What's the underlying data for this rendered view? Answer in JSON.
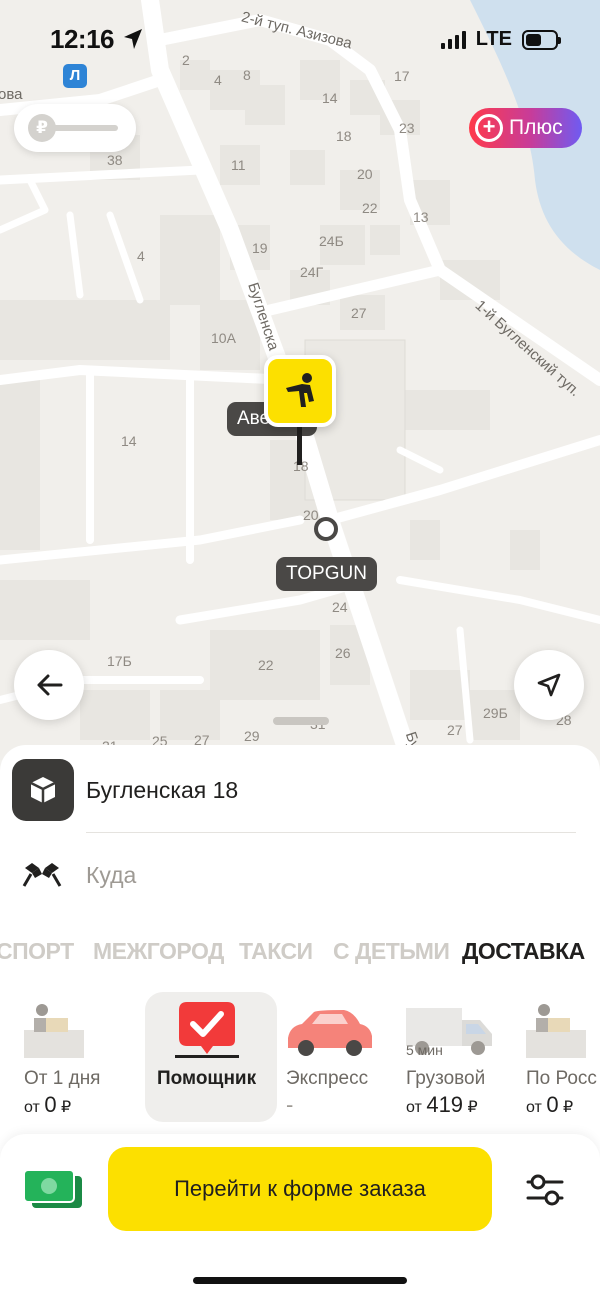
{
  "status_bar": {
    "time": "12:16",
    "network": "LTE"
  },
  "map": {
    "streets": [
      "2-й туп. Азизова",
      "Бугленска",
      "1-й Бугленский туп.",
      "ова",
      "Бу"
    ],
    "house_numbers": [
      "2",
      "4",
      "8",
      "14",
      "17",
      "18",
      "23",
      "38",
      "11",
      "20",
      "22",
      "13",
      "4",
      "19",
      "24Б",
      "24Г",
      "27",
      "10А",
      "14",
      "18",
      "20",
      "24",
      "17Б",
      "22",
      "26",
      "29Б",
      "28",
      "31",
      "21",
      "25",
      "27",
      "29",
      "27"
    ],
    "metro_badge": "Л"
  },
  "cashback": {
    "symbol": "₽"
  },
  "plus": {
    "symbol": "+",
    "label": "Плюс"
  },
  "pickup_tag": "Авеню",
  "point_tag": "TOPGUN",
  "route": {
    "from": "Бугленская 18",
    "to_placeholder": "Куда"
  },
  "tabs": [
    "СПОРТ",
    "МЕЖГОРОД",
    "ТАКСИ",
    "С ДЕТЬМИ",
    "ДОСТАВКА"
  ],
  "active_tab": "ДОСТАВКА",
  "tariffs": [
    {
      "name": "От 1 дня",
      "price_prefix": "от",
      "price": "0",
      "currency": "₽",
      "eta": ""
    },
    {
      "name": "Помощник",
      "price_prefix": "",
      "price": "",
      "currency": "",
      "eta": ""
    },
    {
      "name": "Экспресс",
      "price_prefix": "",
      "price": "-",
      "currency": "",
      "eta": ""
    },
    {
      "name": "Грузовой",
      "price_prefix": "от",
      "price": "419",
      "currency": "₽",
      "eta": "5 мин"
    },
    {
      "name": "По Росс",
      "price_prefix": "от",
      "price": "0",
      "currency": "₽",
      "eta": ""
    }
  ],
  "order_button": "Перейти к форме заказа",
  "colors": {
    "accent": "#fce000",
    "text": "#21201f",
    "muted": "#9e9a94"
  }
}
